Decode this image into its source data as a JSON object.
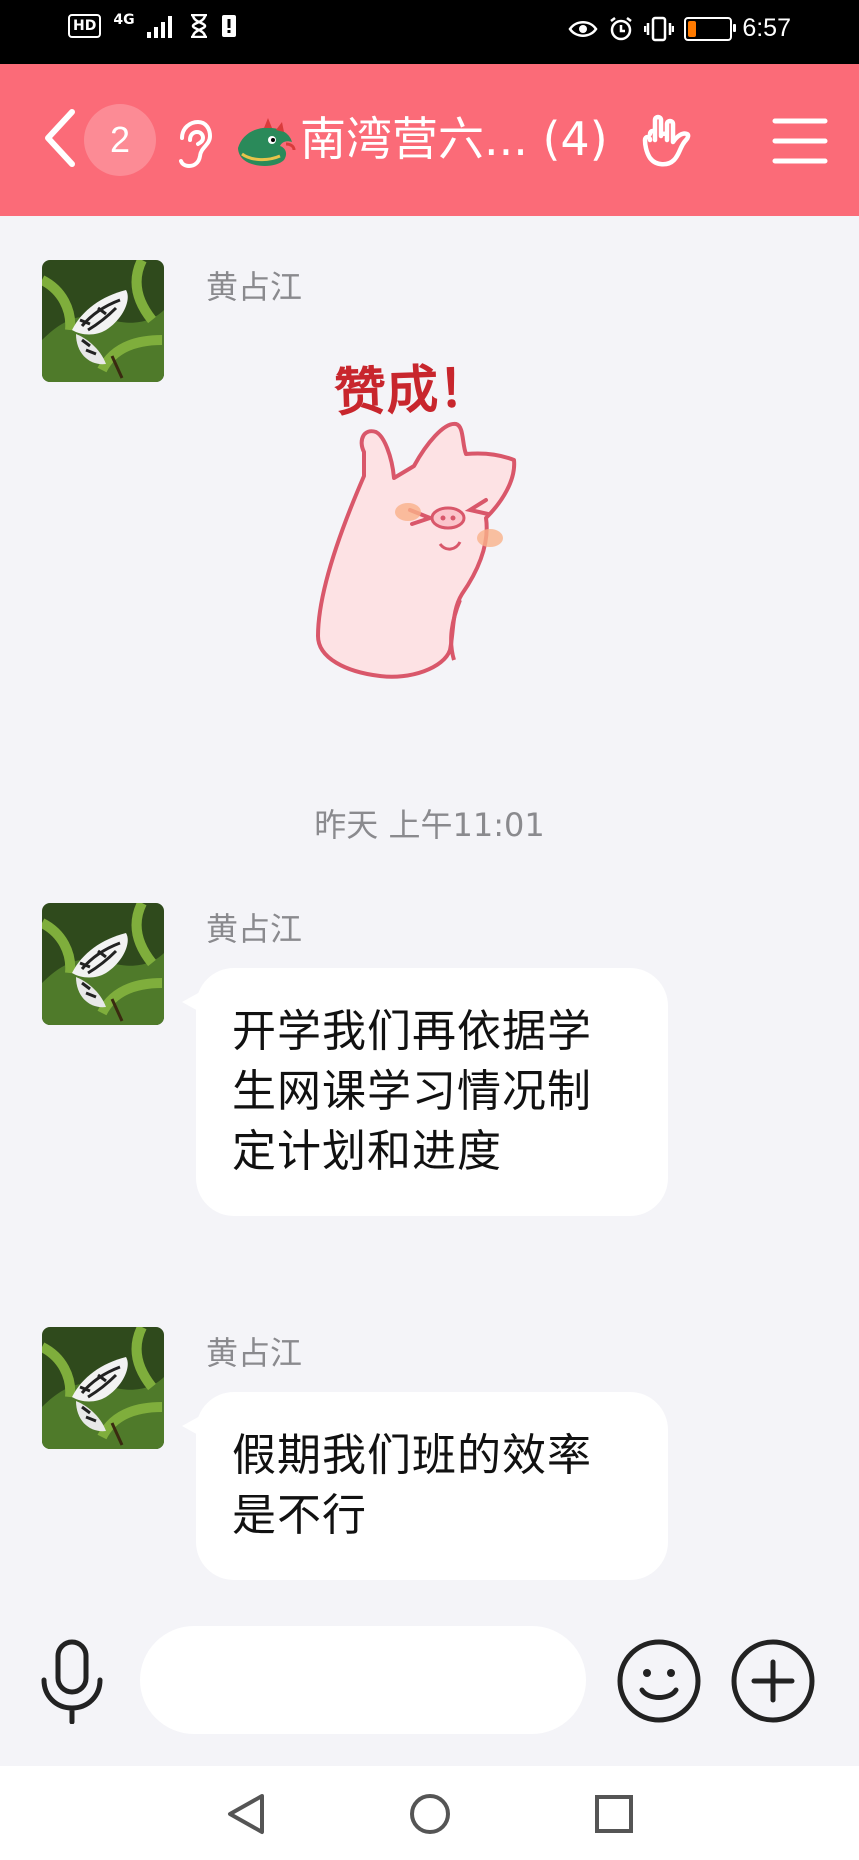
{
  "status_bar": {
    "hd": "HD",
    "network": "4G",
    "time": "6:57",
    "battery_level": 0.18,
    "battery_color": "#ff7a00"
  },
  "header": {
    "back_count": "2",
    "title": "南湾营六... (4)",
    "background": "#fb6b78",
    "icons": [
      "back-chevron-icon",
      "ear-icon",
      "dragon-emoji-icon",
      "hand-gesture-icon",
      "menu-icon"
    ]
  },
  "messages": [
    {
      "sender": "黄占江",
      "type": "sticker",
      "sticker_text": "赞成！"
    },
    {
      "type": "timestamp",
      "text": "昨天 上午11:01"
    },
    {
      "sender": "黄占江",
      "type": "text",
      "text": "开学我们再依据学生网课学习情况制定计划和进度"
    },
    {
      "sender": "黄占江",
      "type": "text",
      "text": "假期我们班的效率是不行"
    }
  ],
  "input_bar": {
    "placeholder": "",
    "icons": [
      "microphone-icon",
      "emoji-icon",
      "plus-icon"
    ]
  },
  "nav_bar": {
    "icons": [
      "nav-back-icon",
      "nav-home-icon",
      "nav-recents-icon"
    ]
  }
}
